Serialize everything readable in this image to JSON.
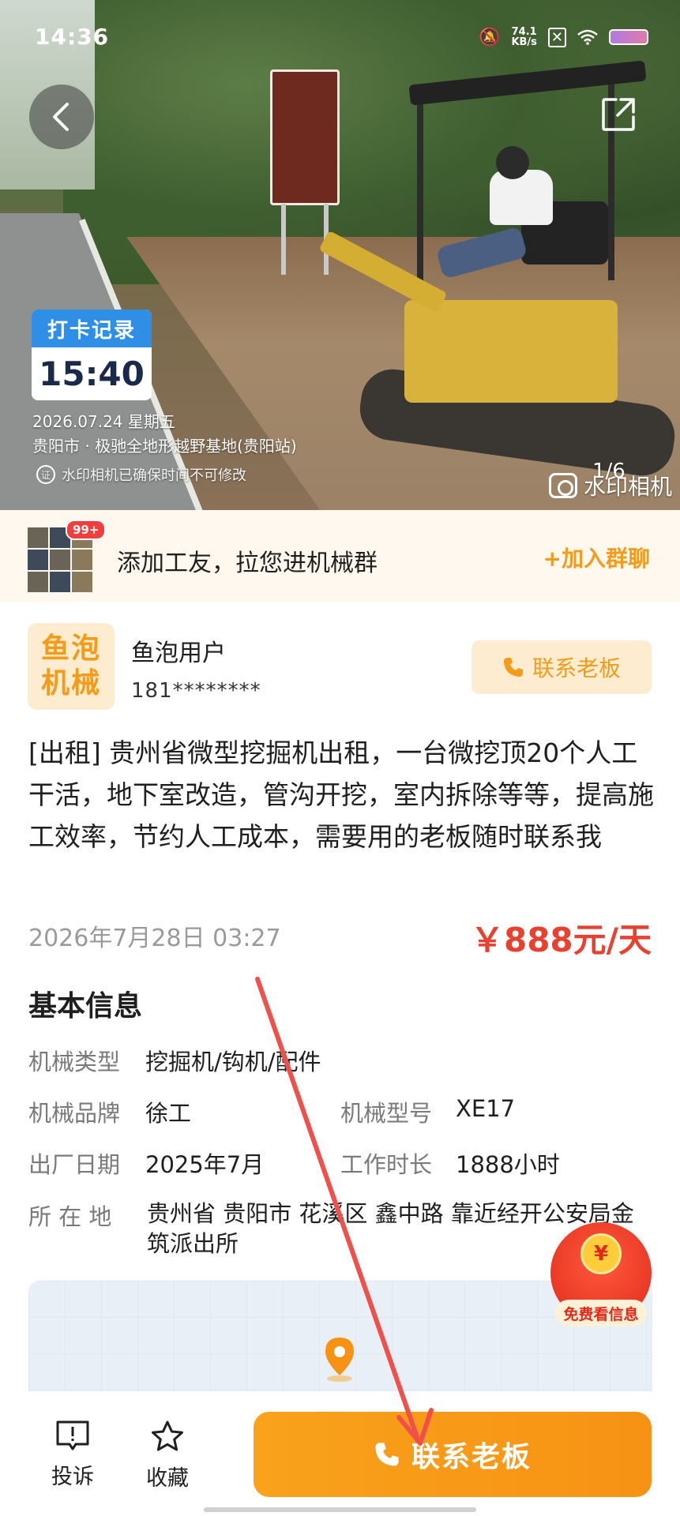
{
  "status_bar": {
    "time": "14:36",
    "net_speed": "74.1",
    "net_unit": "KB/s"
  },
  "hero": {
    "watermark_title": "打卡记录",
    "watermark_time": "15:40",
    "watermark_date": "2026.07.24 星期五",
    "watermark_place": "贵阳市 · 极驰全地形越野基地(贵阳站)",
    "watermark_note": "水印相机已确保时间不可修改",
    "watermark_seal": "证",
    "photo_counter": "1/6",
    "camera_brand": "水印相机"
  },
  "group_banner": {
    "badge": "99+",
    "text": "添加工友，拉您进机械群",
    "join_label": "+加入群聊"
  },
  "poster": {
    "logo_line1": "鱼泡",
    "logo_line2": "机械",
    "name": "鱼泡用户",
    "phone": "181********",
    "contact_label": "联系老板"
  },
  "listing": {
    "description": "[出租] 贵州省微型挖掘机出租，一台微挖顶20个人工干活，地下室改造，管沟开挖，室内拆除等等，提高施工效率，节约人工成本，需要用的老板随时联系我",
    "date": "2026年7月28日 03:27",
    "price": "￥888元/天"
  },
  "basic_info": {
    "title": "基本信息",
    "type_label": "机械类型",
    "type_value": "挖掘机/钩机/配件",
    "brand_label": "机械品牌",
    "brand_value": "徐工",
    "model_label": "机械型号",
    "model_value": "XE17",
    "date_label": "出厂日期",
    "date_value": "2025年7月",
    "hours_label": "工作时长",
    "hours_value": "1888小时",
    "location_label": "所 在 地",
    "location_value": "贵州省 贵阳市 花溪区 鑫中路 靠近经开公安局金筑派出所"
  },
  "free_badge": {
    "coin": "¥",
    "label": "免费看信息"
  },
  "bottom_bar": {
    "report_label": "投诉",
    "favorite_label": "收藏",
    "cta_label": "联系老板"
  },
  "colors": {
    "accent": "#f79214",
    "price": "#e8412f",
    "arrow": "#f0504a"
  }
}
